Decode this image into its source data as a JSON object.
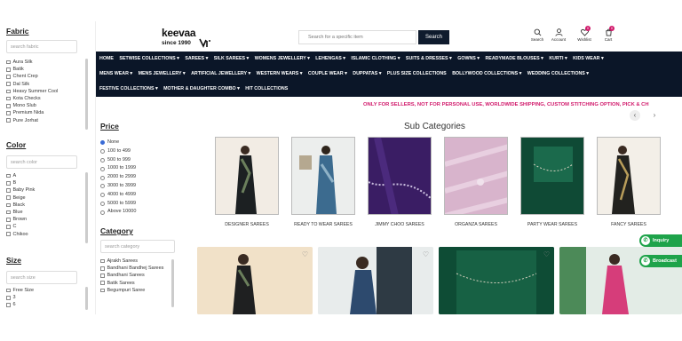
{
  "filters": {
    "fabric": {
      "title": "Fabric",
      "placeholder": "search fabric",
      "items": [
        "Aura Silk",
        "Batik",
        "Chent Crep",
        "Dal Silk",
        "Heavy Summer Cool",
        "Kota Checks",
        "Mono Slub",
        "Premium Nida",
        "Pure Jorhat"
      ]
    },
    "color": {
      "title": "Color",
      "placeholder": "search color",
      "items": [
        "A",
        "B",
        "Baby Pink",
        "Beige",
        "Black",
        "Blue",
        "Brown",
        "C",
        "Chikoo"
      ]
    },
    "size": {
      "title": "Size",
      "placeholder": "search size",
      "items": [
        "Free Size",
        "3",
        "6"
      ]
    },
    "price": {
      "title": "Price",
      "items": [
        "None",
        "100 to 499",
        "500 to 999",
        "1000 to 1999",
        "2000 to 2999",
        "3000 to 3999",
        "4000 to 4999",
        "5000 to 5999",
        "Above 10000"
      ],
      "selected_index": 0
    },
    "category": {
      "title": "Category",
      "placeholder": "search category",
      "items": [
        "Ajrakh Sarees",
        "Bandhani Bandhej Sarees",
        "Bandhani Sarees",
        "Batik Sarees",
        "Begumpuri Saree"
      ]
    }
  },
  "header": {
    "logo_word": "keevaa",
    "logo_tagline": "since 1990",
    "search_placeholder": "Search for a specific item",
    "search_button": "Search",
    "icons": [
      {
        "icon": "search-icon",
        "label": "Search"
      },
      {
        "icon": "account-icon",
        "label": "Account"
      },
      {
        "icon": "heart-icon",
        "label": "Wishlist",
        "badge": "0"
      },
      {
        "icon": "cart-icon",
        "label": "Cart",
        "badge": "0"
      }
    ]
  },
  "nav": {
    "row1": [
      "HOME",
      "SETWISE COLLECTIONS ▾",
      "SAREES ▾",
      "SILK SAREES ▾",
      "WOMENS JEWELLERY ▾",
      "LEHENGAS ▾",
      "ISLAMIC CLOTHING ▾",
      "SUITS & DRESSES ▾",
      "GOWNS ▾",
      "READYMADE BLOUSES ▾",
      "KURTI ▾",
      "KIDS WEAR ▾"
    ],
    "row2": [
      "MENS WEAR ▾",
      "MENS JEWELLERY ▾",
      "ARTIFICIAL JEWELLERY ▾",
      "WESTERN WEARS ▾",
      "COUPLE WEAR ▾",
      "DUPPATAS ▾",
      "PLUS SIZE COLLECTIONS",
      "BOLLYWOOD COLLECTIONS ▾",
      "WEDDING COLLECTIONS ▾"
    ],
    "row3": [
      "FESTIVE COLLECTIONS ▾",
      "MOTHER & DAUGHTER COMBO ▾",
      "HIT COLLECTIONS"
    ]
  },
  "promo_text": "ONLY FOR SELLERS, NOT FOR PERSONAL USE, WORLDWIDE SHIPPING, CUSTOM STITCHING OPTION, PICK & CH",
  "sub_categories": {
    "title": "Sub Categories",
    "items": [
      "DESIGNER SAREES",
      "READY TO WEAR SAREES",
      "JIMMY CHOO SAREES",
      "ORGANZA SAREES",
      "PARTY WEAR SAREES",
      "FANCY SAREES"
    ]
  },
  "whatsapp": {
    "inquiry": "Inquiry",
    "broadcast": "Broadcast"
  },
  "colors": {
    "nav_bg": "#0b1628",
    "accent": "#d1196b",
    "whatsapp": "#1ea34a"
  }
}
